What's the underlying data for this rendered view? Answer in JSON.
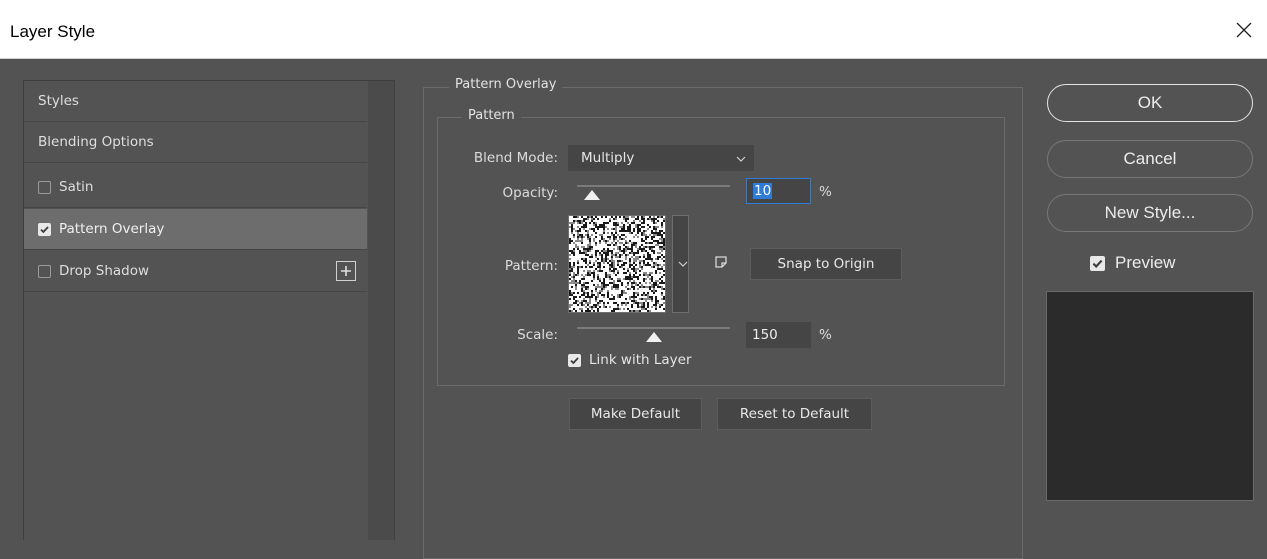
{
  "window": {
    "title": "Layer Style"
  },
  "styles_list": {
    "items": [
      {
        "label": "Styles",
        "has_checkbox": false,
        "checked": false,
        "selected": false
      },
      {
        "label": "Blending Options",
        "has_checkbox": false,
        "checked": false,
        "selected": false
      },
      {
        "label": "Satin",
        "has_checkbox": true,
        "checked": false,
        "selected": false
      },
      {
        "label": "Pattern Overlay",
        "has_checkbox": true,
        "checked": true,
        "selected": true
      },
      {
        "label": "Drop Shadow",
        "has_checkbox": true,
        "checked": false,
        "selected": false
      }
    ]
  },
  "pattern_overlay": {
    "group_title": "Pattern Overlay",
    "subgroup_title": "Pattern",
    "blend_mode_label": "Blend Mode:",
    "blend_mode_value": "Multiply",
    "opacity_label": "Opacity:",
    "opacity_value": "10",
    "opacity_fraction": 0.1,
    "percent": "%",
    "pattern_label": "Pattern:",
    "snap_button": "Snap to Origin",
    "scale_label": "Scale:",
    "scale_value": "150",
    "scale_fraction": 0.5,
    "link_with_layer": "Link with Layer",
    "link_checked": true,
    "make_default": "Make Default",
    "reset_default": "Reset to Default"
  },
  "actions": {
    "ok": "OK",
    "cancel": "Cancel",
    "new_style": "New Style...",
    "preview": "Preview",
    "preview_checked": true
  },
  "colors": {
    "dialog_bg": "#535353",
    "selected_row": "#6d6d6d",
    "field_bg": "#454545",
    "focus_blue": "#2f7bd8",
    "preview_bg": "#2b2b2b"
  },
  "icons": {
    "close": "close-icon",
    "add_effect": "plus-icon",
    "dropdown": "chevron-down-icon",
    "new_preset": "new-preset-icon",
    "checkbox": "checkbox-icon"
  }
}
